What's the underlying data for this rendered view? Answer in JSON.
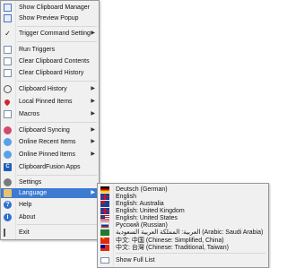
{
  "main_menu": {
    "items": [
      {
        "label": "Show Clipboard Manager",
        "icon": "clipboard-manager-icon"
      },
      {
        "label": "Show Preview Popup",
        "icon": "preview-popup-icon"
      },
      {
        "label": "Trigger Command Setting",
        "icon": "checkmark-icon",
        "submenu": true,
        "checked": true
      },
      {
        "label": "Run Triggers",
        "icon": "run-triggers-icon"
      },
      {
        "label": "Clear Clipboard Contents",
        "icon": "clear-contents-icon"
      },
      {
        "label": "Clear Clipboard History",
        "icon": "clear-history-icon"
      },
      {
        "label": "Clipboard History",
        "icon": "clock-icon",
        "submenu": true
      },
      {
        "label": "Local Pinned Items",
        "icon": "pin-icon",
        "submenu": true
      },
      {
        "label": "Macros",
        "icon": "macro-icon",
        "submenu": true
      },
      {
        "label": "Clipboard Syncing",
        "icon": "sync-icon",
        "submenu": true
      },
      {
        "label": "Online Recent Items",
        "icon": "cloud-icon",
        "submenu": true
      },
      {
        "label": "Online Pinned Items",
        "icon": "cloud-pin-icon",
        "submenu": true
      },
      {
        "label": "ClipboardFusion Apps",
        "icon": "cf-apps-icon"
      },
      {
        "label": "Settings",
        "icon": "gear-icon"
      },
      {
        "label": "Language",
        "icon": "language-icon",
        "submenu": true,
        "highlighted": true
      },
      {
        "label": "Help",
        "icon": "help-icon"
      },
      {
        "label": "About",
        "icon": "info-icon"
      },
      {
        "label": "Exit",
        "icon": "exit-icon"
      }
    ]
  },
  "language_menu": {
    "items": [
      {
        "label": "Deutsch (German)",
        "icon": "flag-germany-icon"
      },
      {
        "label": "English",
        "icon": "flag-uk-icon"
      },
      {
        "label": "English: Australia",
        "icon": "flag-australia-icon"
      },
      {
        "label": "English: United Kingdom",
        "icon": "flag-uk-icon"
      },
      {
        "label": "English: United States",
        "icon": "flag-us-icon"
      },
      {
        "label": "Русский (Russian)",
        "icon": "flag-russia-icon"
      },
      {
        "label": "العربية: المملكة العربية السعودية (Arabic: Saudi Arabia)",
        "icon": "flag-saudi-arabia-icon"
      },
      {
        "label": "中文: 中国 (Chinese: Simplified, China)",
        "icon": "flag-china-icon"
      },
      {
        "label": "中文: 台灣 (Chinese: Traditional, Taiwan)",
        "icon": "flag-taiwan-icon"
      },
      {
        "label": "Show Full List",
        "icon": "full-list-icon"
      }
    ]
  },
  "colors": {
    "highlight": "#3d7bd3",
    "menu_bg": "#f0f0f0",
    "border": "#979797"
  }
}
